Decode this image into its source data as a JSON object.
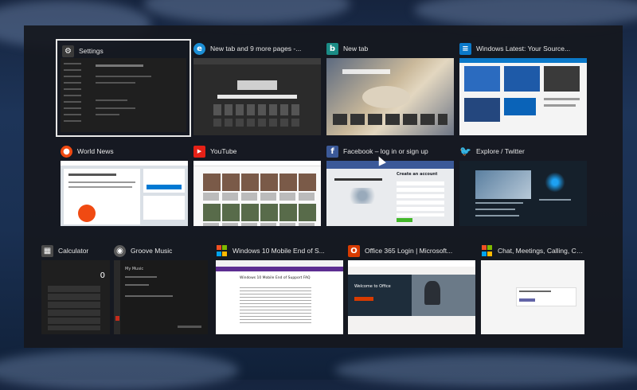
{
  "windows": [
    {
      "id": "settings",
      "title": "Settings",
      "icon": "gear-icon",
      "icon_color": "#3a3a3a",
      "icon_glyph": "⚙"
    },
    {
      "id": "edge-newtab",
      "title": "New tab and 9 more pages -...",
      "icon": "edge-icon",
      "icon_color": "#1c8fd6",
      "icon_glyph": "e"
    },
    {
      "id": "bing-newtab",
      "title": "New tab",
      "icon": "bing-icon",
      "icon_color": "#1a8c86",
      "icon_glyph": "b"
    },
    {
      "id": "windows-latest",
      "title": "Windows Latest: Your Source...",
      "icon": "windows-latest-icon",
      "icon_color": "#0b79c9",
      "icon_glyph": "≡"
    },
    {
      "id": "world-news",
      "title": "World News",
      "icon": "reddit-icon",
      "icon_color": "#f04a12",
      "icon_glyph": "●"
    },
    {
      "id": "youtube",
      "title": "YouTube",
      "icon": "youtube-icon",
      "icon_color": "#e62117",
      "icon_glyph": "▶"
    },
    {
      "id": "facebook",
      "title": "Facebook – log in or sign up",
      "icon": "facebook-icon",
      "icon_color": "#3b5998",
      "icon_glyph": "f"
    },
    {
      "id": "twitter",
      "title": "Explore / Twitter",
      "icon": "twitter-icon",
      "icon_color": "#1da1f2",
      "icon_glyph": "🐦"
    },
    {
      "id": "calculator",
      "title": "Calculator",
      "icon": "calculator-icon",
      "icon_color": "#4a4a4a",
      "icon_glyph": "▦"
    },
    {
      "id": "groove",
      "title": "Groove Music",
      "icon": "groove-music-icon",
      "icon_color": "#5a5a5a",
      "icon_glyph": "◉"
    },
    {
      "id": "win10mobile",
      "title": "Windows 10 Mobile End of S...",
      "icon": "microsoft-icon",
      "icon_color": "#f25022",
      "icon_glyph": "■"
    },
    {
      "id": "office365",
      "title": "Office 365 Login | Microsoft...",
      "icon": "office-icon",
      "icon_color": "#d83b01",
      "icon_glyph": "O"
    },
    {
      "id": "teams-chat",
      "title": "Chat, Meetings, Calling, Colla...",
      "icon": "microsoft-icon",
      "icon_color": "#f25022",
      "icon_glyph": "■"
    }
  ],
  "thumbs": {
    "settings_header": "Settings",
    "calc_display": "0",
    "groove_title": "My Music",
    "win10_heading": "Windows 10 Mobile End of Support FAQ",
    "office_banner": "Welcome to Office",
    "fb_create": "Create an account"
  }
}
